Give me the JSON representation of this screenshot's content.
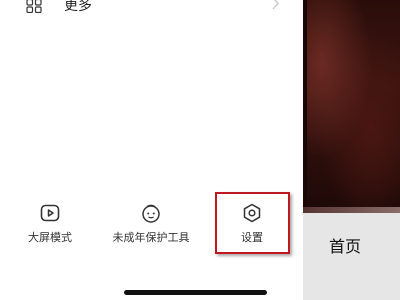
{
  "menu": {
    "more": {
      "label": "更多",
      "icon": "grid-icon"
    }
  },
  "tools": [
    {
      "label": "大屏模式",
      "icon": "tv-screen-icon"
    },
    {
      "label": "未成年保护工具",
      "icon": "child-face-icon"
    },
    {
      "label": "设置",
      "icon": "settings-icon"
    }
  ],
  "side": {
    "home_tab_label": "首页"
  },
  "colors": {
    "highlight_border": "#c0181f",
    "side_video_bg": "#3c1410",
    "home_tab_bg": "#e6e6e6"
  }
}
